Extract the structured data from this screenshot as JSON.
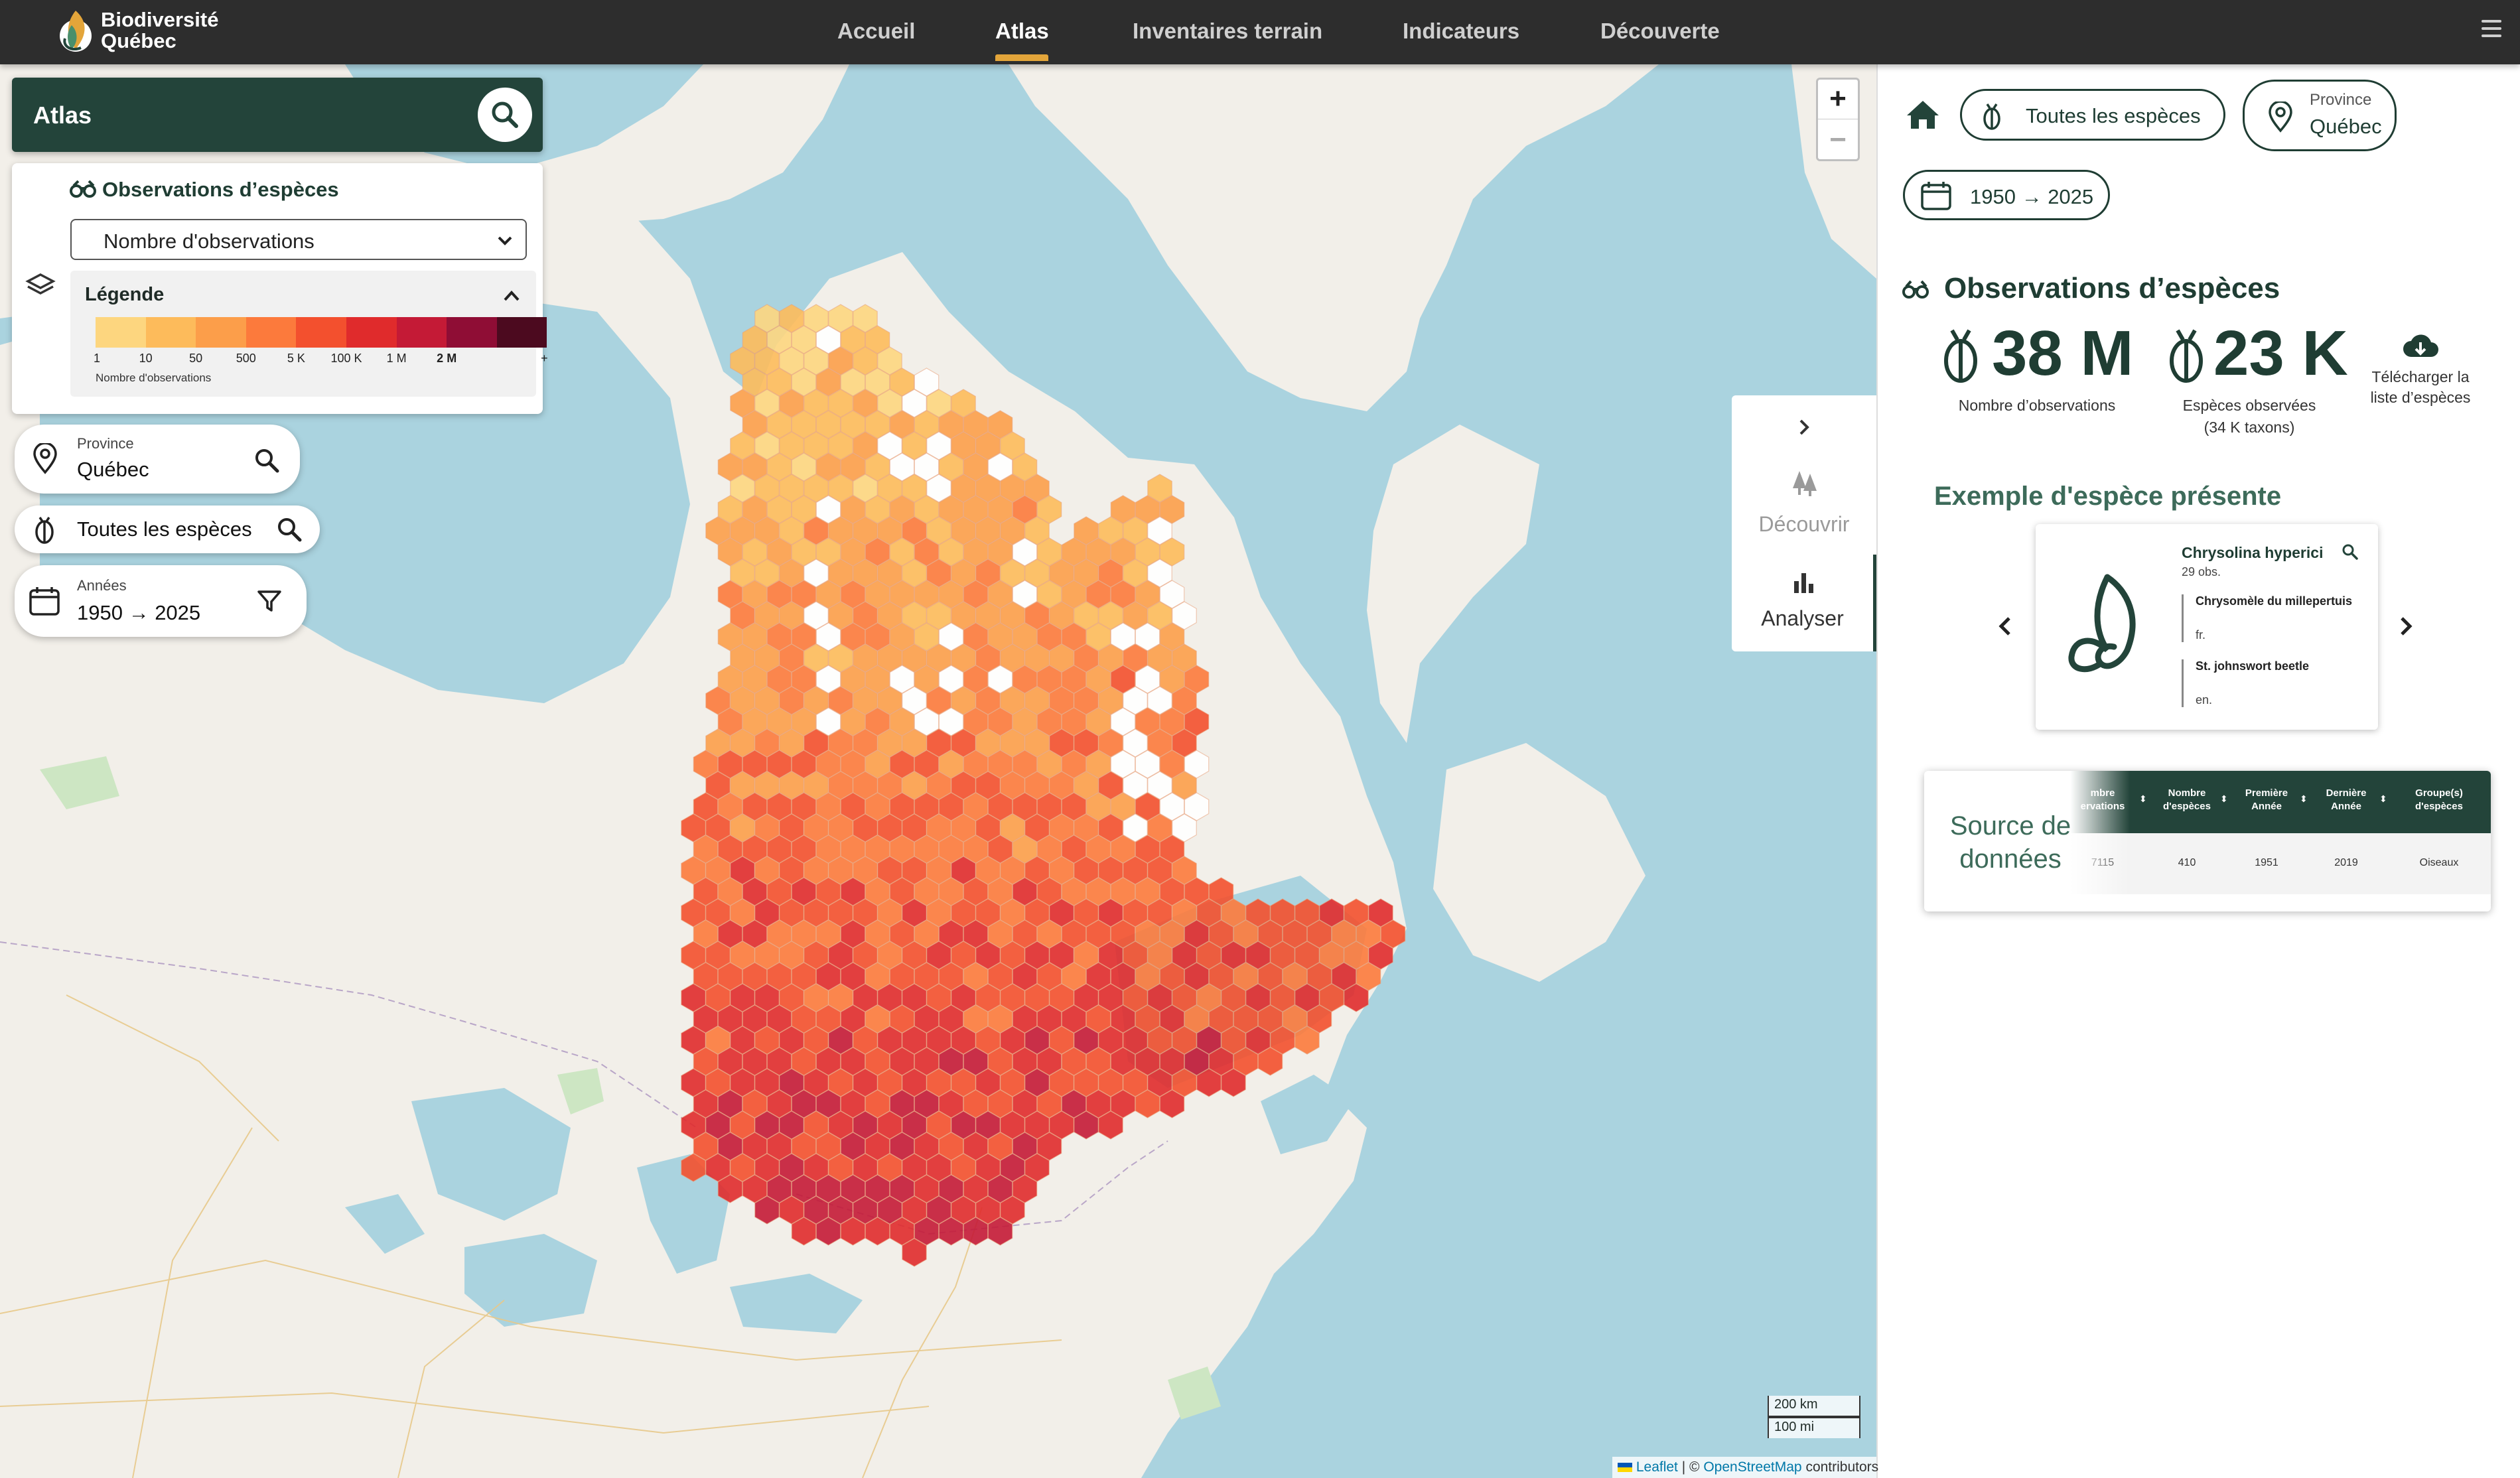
{
  "app": {
    "logo_line1": "Biodiversité",
    "logo_line2": "Québec"
  },
  "nav": {
    "items": [
      "Accueil",
      "Atlas",
      "Inventaires terrain",
      "Indicateurs",
      "Découverte"
    ],
    "active": "Atlas"
  },
  "atlas_panel": {
    "title": "Atlas",
    "layer_title": "Observations d’espèces",
    "select_value": "Nombre d'observations",
    "legend_title": "Légende",
    "legend_labels": [
      "1",
      "10",
      "50",
      "500",
      "5 K",
      "100 K",
      "1 M",
      "2 M",
      "+"
    ],
    "legend_caption": "Nombre d'observations",
    "legend_colors": [
      "#fdd67f",
      "#fdbb5b",
      "#fc9e4a",
      "#fc7a3c",
      "#f3502e",
      "#e02b2c",
      "#c41a36",
      "#8f0d35",
      "#4c0a1f"
    ]
  },
  "filters": {
    "province_label": "Province",
    "province_value": "Québec",
    "species_value": "Toutes les espèces",
    "years_label": "Années",
    "years_value": "1950 → 2025"
  },
  "map": {
    "zoom_in": "+",
    "zoom_out": "−",
    "scale_km": "200 km",
    "scale_mi": "100 mi",
    "attribution_leaflet": "Leaflet",
    "attribution_sep": " | © ",
    "attribution_osm": "OpenStreetMap",
    "attribution_tail": " contributors",
    "colors": {
      "water": "#aad3df",
      "land": "#f2efe9",
      "green": "#cde6c3"
    }
  },
  "side_tabs": {
    "decouvrir": "Découvrir",
    "analyser": "Analyser"
  },
  "right": {
    "chip_species": "Toutes les espèces",
    "chip_province_label": "Province",
    "chip_province_value": "Québec",
    "chip_years": "1950 → 2025",
    "section_title": "Observations d’espèces",
    "stat_obs_value": "38 M",
    "stat_obs_label": "Nombre d’observations",
    "stat_species_value": "23 K",
    "stat_species_label_1": "Espèces observées",
    "stat_species_label_2": "(34 K taxons)",
    "download_label_1": "Télécharger la",
    "download_label_2": "liste d’espèces",
    "example_title": "Exemple d'espèce présente",
    "species": {
      "scientific": "Chrysolina hyperici",
      "obs": "29 obs.",
      "vernacular_fr": "Chrysomèle du millepertuis",
      "lang_fr": "fr.",
      "vernacular_en": "St. johnswort beetle",
      "lang_en": "en."
    },
    "source_title_1": "Source de",
    "source_title_2": "données",
    "source_table": {
      "headers": [
        [
          "mbre",
          "ervations"
        ],
        [
          "Nombre",
          "d'espèces"
        ],
        [
          "Première",
          "Année"
        ],
        [
          "Dernière",
          "Année"
        ],
        [
          "Groupe(s)",
          "d'espèces"
        ]
      ],
      "row": [
        "7115",
        "410",
        "1951",
        "2019",
        "Oiseaux"
      ]
    }
  }
}
